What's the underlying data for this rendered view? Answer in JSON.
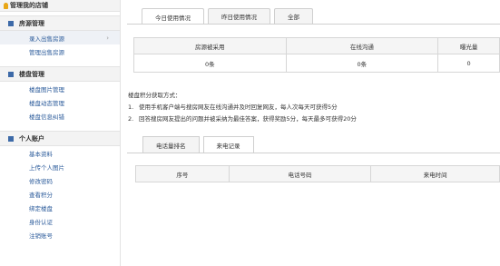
{
  "sidebar": {
    "title": "管理我的店铺",
    "sections": [
      {
        "label": "房源管理",
        "items": [
          "录入出售房源",
          "管理出售房源"
        ]
      },
      {
        "label": "楼盘管理",
        "items": [
          "楼盘图片管理",
          "楼盘动态管理",
          "楼盘信息纠错"
        ]
      },
      {
        "label": "个人账户",
        "items": [
          "基本资料",
          "上传个人图片",
          "修改密码",
          "查看积分",
          "绑定楼盘",
          "身份认证",
          "注销账号"
        ]
      }
    ],
    "active_chevron": "›"
  },
  "usage_tabs": [
    "今日使用情况",
    "昨日使用情况",
    "全部"
  ],
  "stats": {
    "headers": [
      "房源被采用",
      "在线沟通",
      "曝光量"
    ],
    "values": [
      "0条",
      "0条",
      "0"
    ]
  },
  "rules": {
    "heading": "楼盘积分获取方式：",
    "items": [
      {
        "num": "1.",
        "text": "使用手机客户端与搜房网友在线沟通并及时回复网友，每人次每天可获得5分"
      },
      {
        "num": "2.",
        "text": "回答搜房网友提出的问题并被采纳为最佳答案，获得奖励5分，每天最多可获得20分"
      }
    ]
  },
  "call_tabs": [
    "电话量排名",
    "来电记录"
  ],
  "calls_table": {
    "headers": [
      "序号",
      "电话号码",
      "来电时间"
    ]
  }
}
